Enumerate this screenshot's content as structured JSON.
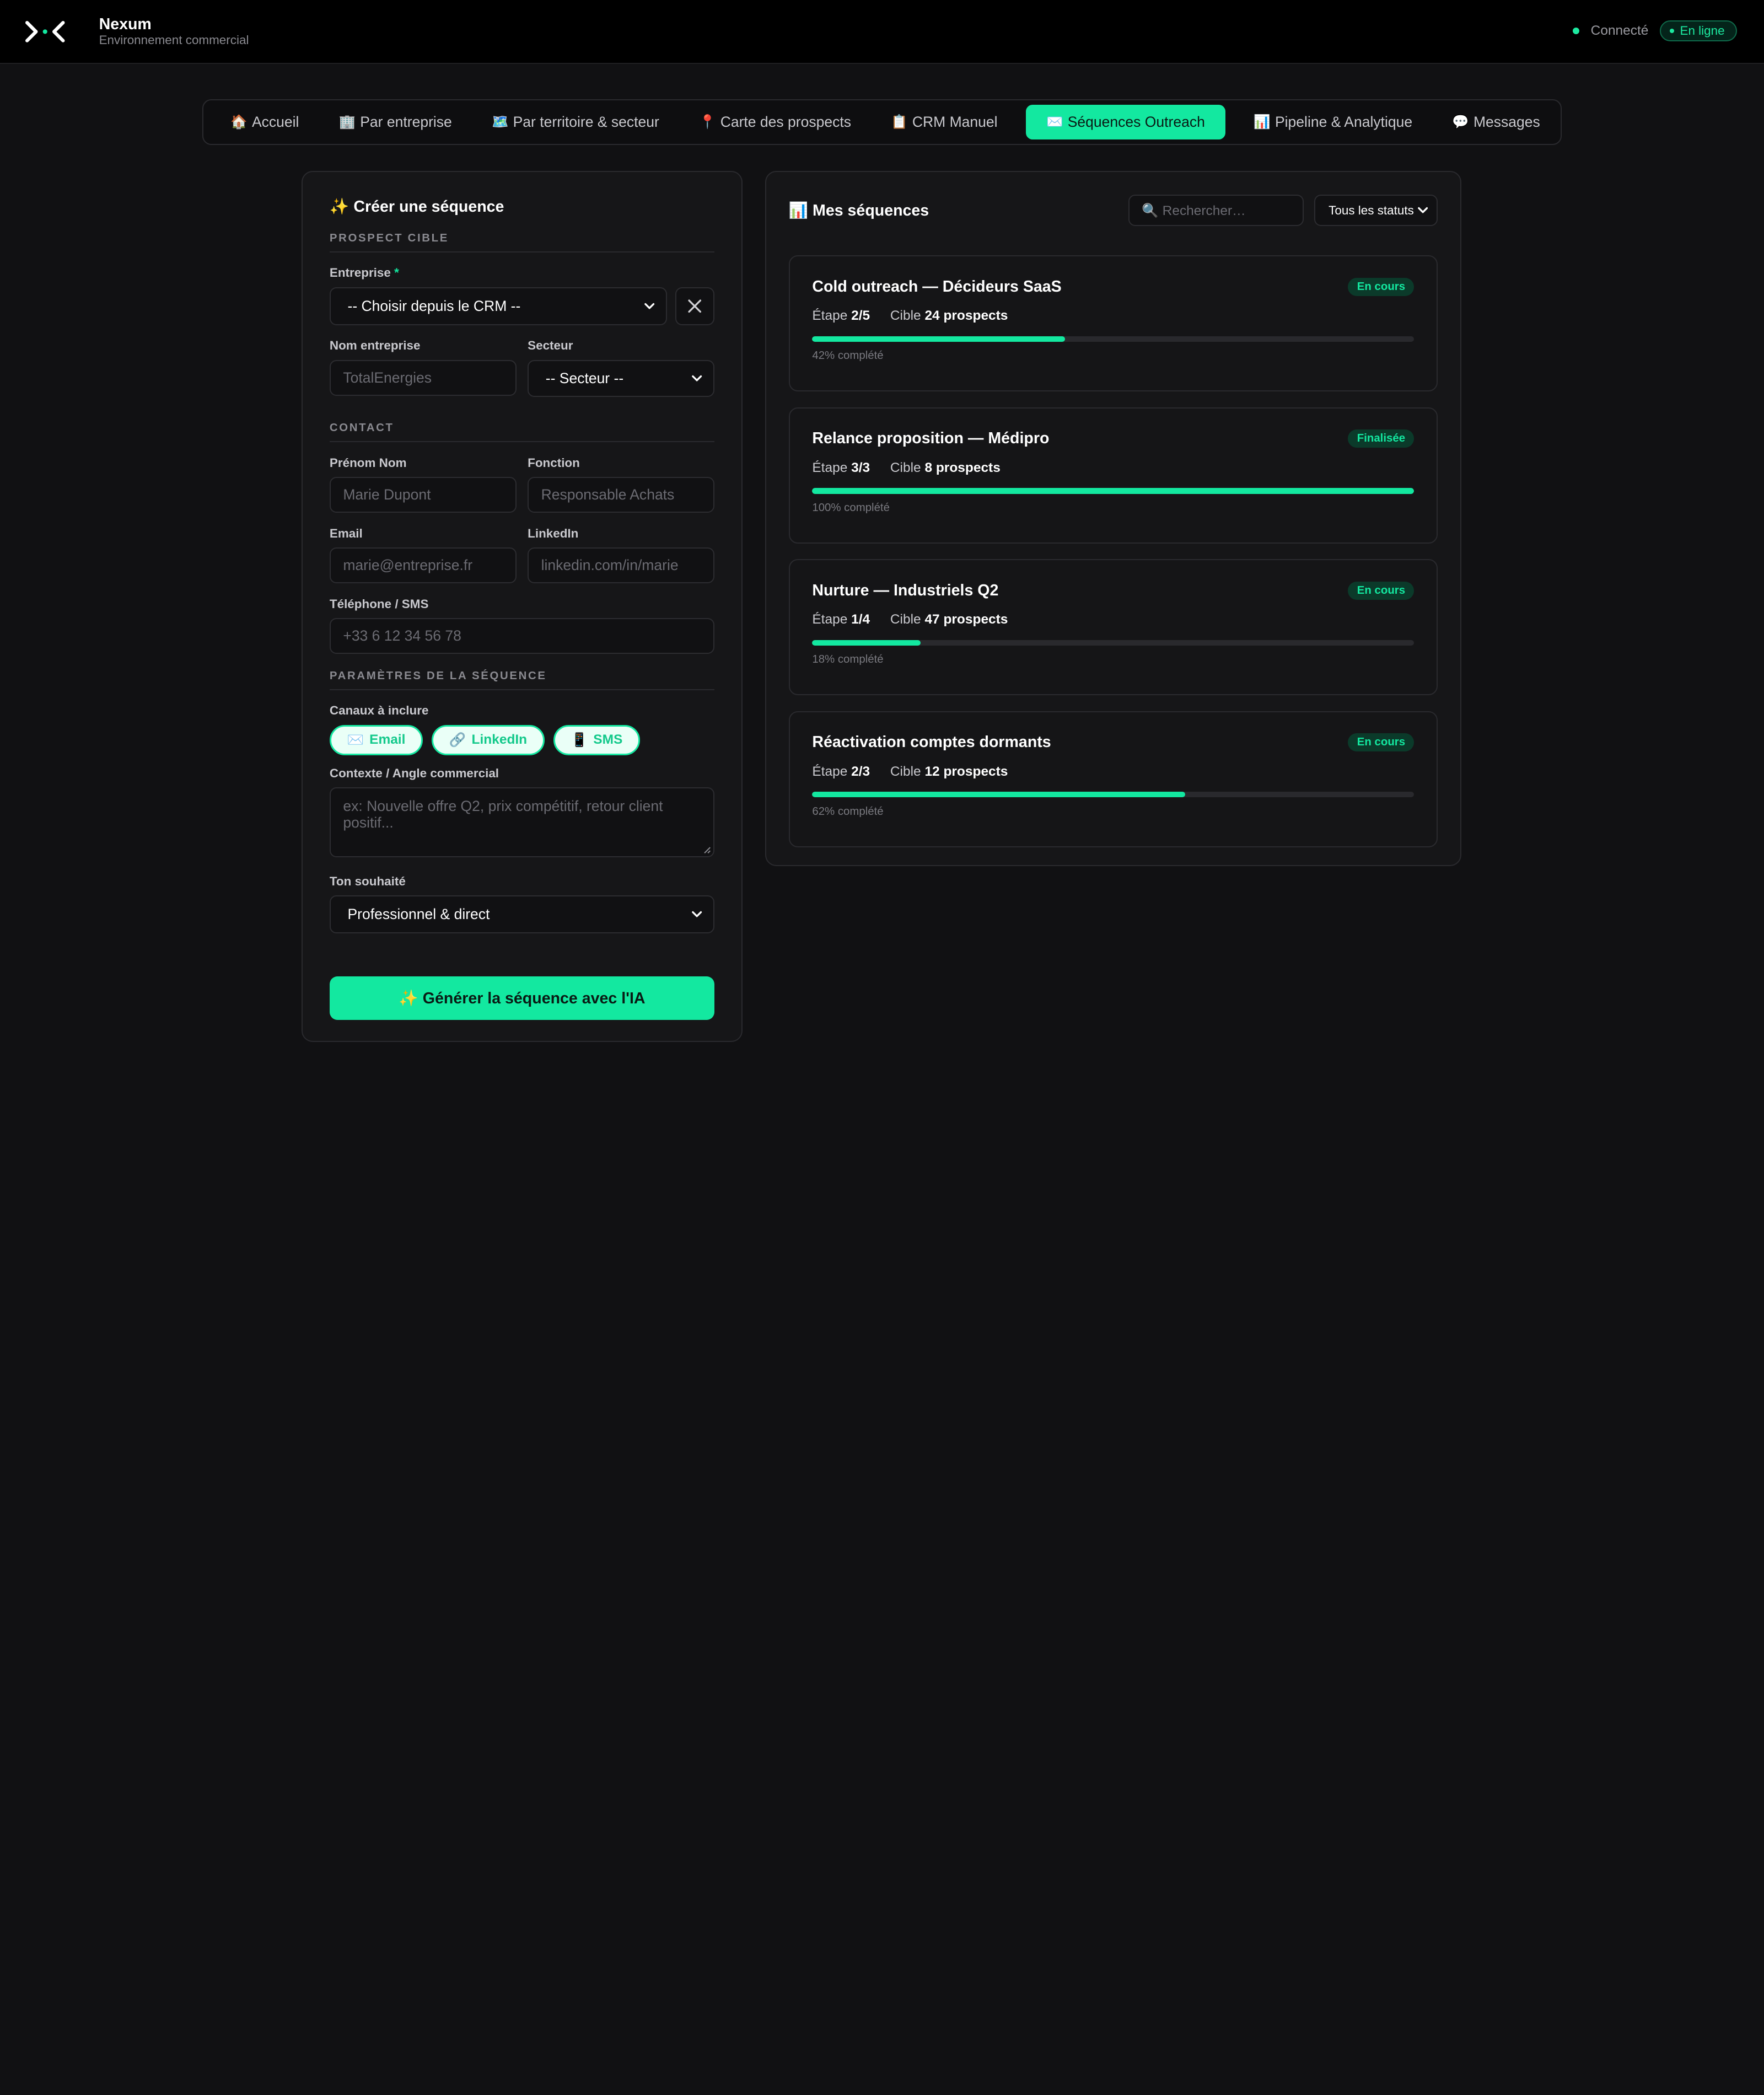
{
  "app": {
    "brand": "Nexum",
    "subtitle": "Environnement commercial",
    "status_label": "Connecté",
    "online_label": "En ligne",
    "accent": "#13e8a0"
  },
  "nav": {
    "tabs": [
      {
        "icon": "🏠",
        "label": "Accueil"
      },
      {
        "icon": "🏢",
        "label": "Par entreprise"
      },
      {
        "icon": "🗺️",
        "label": "Par territoire & secteur"
      },
      {
        "icon": "📍",
        "label": "Carte des prospects"
      },
      {
        "icon": "📋",
        "label": "CRM Manuel"
      },
      {
        "icon": "✉️",
        "label": "Séquences Outreach"
      },
      {
        "icon": "📊",
        "label": "Pipeline & Analytique"
      },
      {
        "icon": "💬",
        "label": "Messages"
      }
    ],
    "active": "Séquences Outreach"
  },
  "create": {
    "title": "✨ Créer une séquence",
    "section_prospect": "PROSPECT CIBLE",
    "company_label": "Entreprise",
    "company_required": "*",
    "company_select": "-- Choisir depuis le CRM --",
    "company_name_label": "Nom entreprise",
    "company_name_placeholder": "TotalEnergies",
    "sector_label": "Secteur",
    "sector_select": "-- Secteur --",
    "section_contact": "CONTACT",
    "name_label": "Prénom Nom",
    "name_placeholder": "Marie Dupont",
    "role_label": "Fonction",
    "role_placeholder": "Responsable Achats",
    "email_label": "Email",
    "email_placeholder": "marie@entreprise.fr",
    "linkedin_label": "LinkedIn",
    "linkedin_placeholder": "linkedin.com/in/marie",
    "phone_label": "Téléphone / SMS",
    "phone_placeholder": "+33 6 12 34 56 78",
    "section_params": "PARAMÈTRES DE LA SÉQUENCE",
    "channels_label": "Canaux à inclure",
    "channels": [
      {
        "icon": "✉️",
        "label": "Email"
      },
      {
        "icon": "🔗",
        "label": "LinkedIn"
      },
      {
        "icon": "📱",
        "label": "SMS"
      }
    ],
    "context_label": "Contexte / Angle commercial",
    "context_placeholder": "ex: Nouvelle offre Q2, prix compétitif, retour client positif...",
    "tone_label": "Ton souhaité",
    "tone_select": "Professionnel & direct",
    "generate_label": "✨ Générer la séquence avec l'IA"
  },
  "sequences": {
    "title": "📊 Mes séquences",
    "search_placeholder": "🔍 Rechercher…",
    "status_filter": "Tous les statuts",
    "items": [
      {
        "title": "Cold outreach — Décideurs SaaS",
        "badge": "En cours",
        "step_label": "Étape",
        "step": "2/5",
        "target_label": "Cible",
        "target": "24 prospects",
        "progress": 42,
        "progress_text": "42% complété"
      },
      {
        "title": "Relance proposition — Médipro",
        "badge": "Finalisée",
        "step_label": "Étape",
        "step": "3/3",
        "target_label": "Cible",
        "target": "8 prospects",
        "progress": 100,
        "progress_text": "100% complété"
      },
      {
        "title": "Nurture — Industriels Q2",
        "badge": "En cours",
        "step_label": "Étape",
        "step": "1/4",
        "target_label": "Cible",
        "target": "47 prospects",
        "progress": 18,
        "progress_text": "18% complété"
      },
      {
        "title": "Réactivation comptes dormants",
        "badge": "En cours",
        "step_label": "Étape",
        "step": "2/3",
        "target_label": "Cible",
        "target": "12 prospects",
        "progress": 62,
        "progress_text": "62% complété"
      }
    ]
  }
}
